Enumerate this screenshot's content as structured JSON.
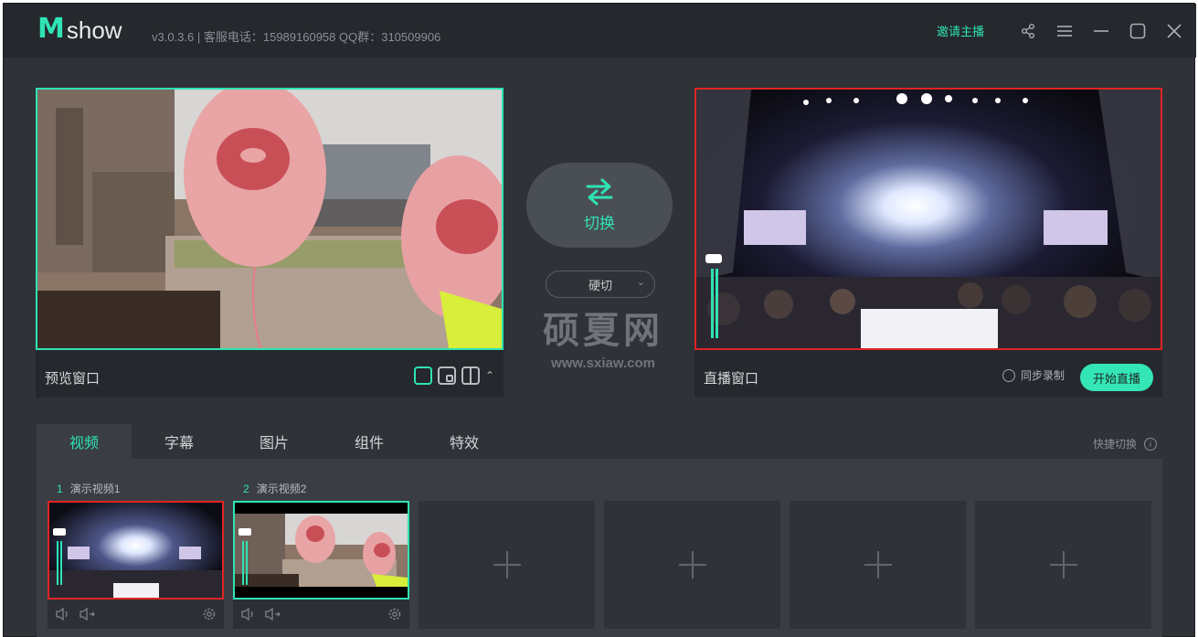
{
  "app": {
    "logo_m": "M",
    "logo_show": "show",
    "version_info": "v3.0.3.6 | 客服电话：15989160958 QQ群：310509906",
    "invite": "邀请主播"
  },
  "preview": {
    "label": "预览窗口"
  },
  "live": {
    "label": "直播窗口",
    "sync_record": "同步录制",
    "go_live": "开始直播"
  },
  "switch": {
    "label": "切换",
    "cut_mode": "硬切"
  },
  "watermark": {
    "big": "硕夏网",
    "small": "www.sxiaw.com"
  },
  "tabs": [
    "视频",
    "字幕",
    "图片",
    "组件",
    "特效"
  ],
  "quick_switch": "快捷切换",
  "sources": [
    {
      "num": "1",
      "name": "演示视频1"
    },
    {
      "num": "2",
      "name": "演示视频2"
    }
  ],
  "colors": {
    "accent": "#2fe3b4",
    "live_border": "#e02424",
    "bg": "#2f3237"
  }
}
